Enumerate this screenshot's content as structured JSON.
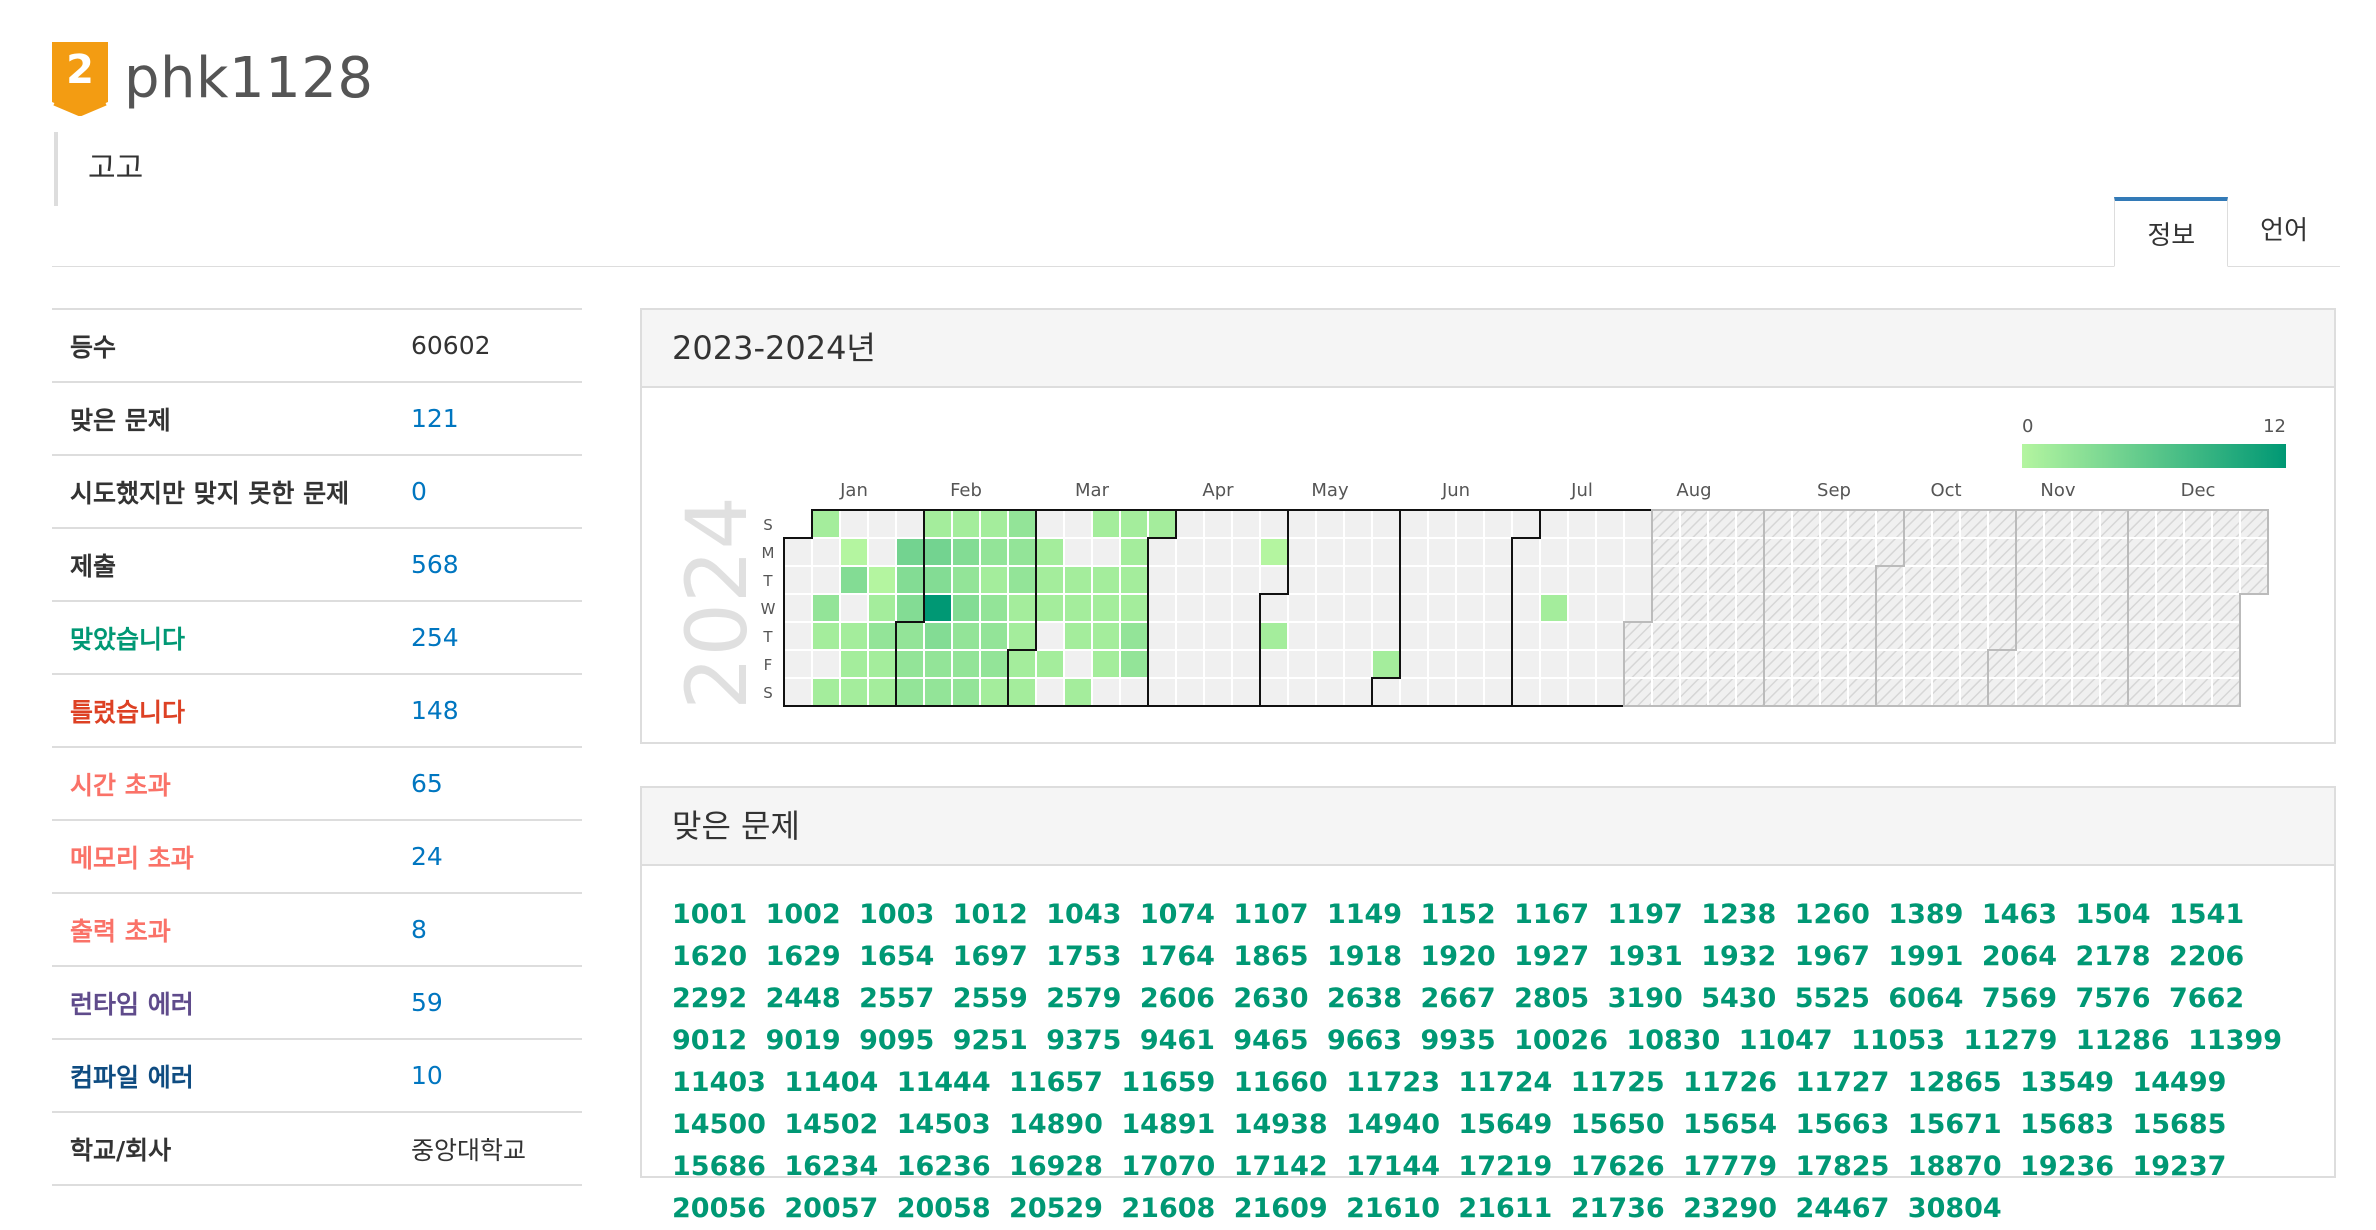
{
  "user": {
    "tier_number": "2",
    "username": "phk1128",
    "status_message": "고고"
  },
  "tabs": [
    {
      "label": "정보",
      "active": true
    },
    {
      "label": "언어",
      "active": false
    }
  ],
  "stats": [
    {
      "label": "등수",
      "value": "60602",
      "label_color": "#333333",
      "value_color": "#333333"
    },
    {
      "label": "맞은 문제",
      "value": "121",
      "label_color": "#333333",
      "value_color": "#0076c0"
    },
    {
      "label": "시도했지만 맞지 못한 문제",
      "value": "0",
      "label_color": "#333333",
      "value_color": "#0076c0"
    },
    {
      "label": "제출",
      "value": "568",
      "label_color": "#333333",
      "value_color": "#0076c0"
    },
    {
      "label": "맞았습니다",
      "value": "254",
      "label_color": "#009874",
      "value_color": "#0076c0"
    },
    {
      "label": "틀렸습니다",
      "value": "148",
      "label_color": "#dd4124",
      "value_color": "#0076c0"
    },
    {
      "label": "시간 초과",
      "value": "65",
      "label_color": "#fa7268",
      "value_color": "#0076c0"
    },
    {
      "label": "메모리 초과",
      "value": "24",
      "label_color": "#fa7268",
      "value_color": "#0076c0"
    },
    {
      "label": "출력 초과",
      "value": "8",
      "label_color": "#fa7268",
      "value_color": "#0076c0"
    },
    {
      "label": "런타임 에러",
      "value": "59",
      "label_color": "#5f4b8b",
      "value_color": "#0076c0"
    },
    {
      "label": "컴파일 에러",
      "value": "10",
      "label_color": "#0f4c81",
      "value_color": "#0076c0"
    },
    {
      "label": "학교/회사",
      "value": "중앙대학교",
      "label_color": "#333333",
      "value_color": "#333333"
    }
  ],
  "calendar": {
    "title": "2023-2024년",
    "year": "2024",
    "legend_min": "0",
    "legend_max": "12",
    "legend_colors": [
      "#b4f5a0",
      "#009874"
    ],
    "months": [
      "Jan",
      "Feb",
      "Mar",
      "Apr",
      "May",
      "Jun",
      "Jul",
      "Aug",
      "Sep",
      "Oct",
      "Nov",
      "Dec"
    ],
    "weekdays": [
      "S",
      "M",
      "T",
      "W",
      "T",
      "F",
      "S"
    ],
    "first_weekday": 1,
    "days_in_year": 366,
    "last_active_day_of_year": 213,
    "activity": [
      {
        "day": 7,
        "level": 2
      },
      {
        "day": 10,
        "level": 3
      },
      {
        "day": 11,
        "level": 2
      },
      {
        "day": 13,
        "level": 2
      },
      {
        "day": 15,
        "level": 1
      },
      {
        "day": 16,
        "level": 4
      },
      {
        "day": 18,
        "level": 2
      },
      {
        "day": 19,
        "level": 2
      },
      {
        "day": 20,
        "level": 2
      },
      {
        "day": 23,
        "level": 1
      },
      {
        "day": 24,
        "level": 2
      },
      {
        "day": 25,
        "level": 3
      },
      {
        "day": 26,
        "level": 2
      },
      {
        "day": 27,
        "level": 2
      },
      {
        "day": 29,
        "level": 5
      },
      {
        "day": 30,
        "level": 4
      },
      {
        "day": 31,
        "level": 4
      },
      {
        "day": 32,
        "level": 3
      },
      {
        "day": 33,
        "level": 3
      },
      {
        "day": 34,
        "level": 3
      },
      {
        "day": 35,
        "level": 2
      },
      {
        "day": 36,
        "level": 5
      },
      {
        "day": 37,
        "level": 4
      },
      {
        "day": 38,
        "level": 12
      },
      {
        "day": 39,
        "level": 4
      },
      {
        "day": 40,
        "level": 3
      },
      {
        "day": 41,
        "level": 3
      },
      {
        "day": 42,
        "level": 2
      },
      {
        "day": 43,
        "level": 4
      },
      {
        "day": 44,
        "level": 3
      },
      {
        "day": 45,
        "level": 4
      },
      {
        "day": 46,
        "level": 3
      },
      {
        "day": 47,
        "level": 3
      },
      {
        "day": 48,
        "level": 3
      },
      {
        "day": 49,
        "level": 2
      },
      {
        "day": 50,
        "level": 3
      },
      {
        "day": 51,
        "level": 2
      },
      {
        "day": 52,
        "level": 3
      },
      {
        "day": 53,
        "level": 3
      },
      {
        "day": 54,
        "level": 3
      },
      {
        "day": 55,
        "level": 2
      },
      {
        "day": 56,
        "level": 3
      },
      {
        "day": 57,
        "level": 3
      },
      {
        "day": 58,
        "level": 3
      },
      {
        "day": 59,
        "level": 2
      },
      {
        "day": 60,
        "level": 2
      },
      {
        "day": 61,
        "level": 2
      },
      {
        "day": 62,
        "level": 2
      },
      {
        "day": 64,
        "level": 2
      },
      {
        "day": 65,
        "level": 2
      },
      {
        "day": 66,
        "level": 2
      },
      {
        "day": 68,
        "level": 2
      },
      {
        "day": 72,
        "level": 2
      },
      {
        "day": 73,
        "level": 2
      },
      {
        "day": 74,
        "level": 2
      },
      {
        "day": 76,
        "level": 2
      },
      {
        "day": 77,
        "level": 2
      },
      {
        "day": 79,
        "level": 2
      },
      {
        "day": 80,
        "level": 2
      },
      {
        "day": 81,
        "level": 2
      },
      {
        "day": 82,
        "level": 2
      },
      {
        "day": 84,
        "level": 2
      },
      {
        "day": 85,
        "level": 2
      },
      {
        "day": 86,
        "level": 2
      },
      {
        "day": 87,
        "level": 2
      },
      {
        "day": 88,
        "level": 3
      },
      {
        "day": 89,
        "level": 3
      },
      {
        "day": 91,
        "level": 2
      },
      {
        "day": 120,
        "level": 1
      },
      {
        "day": 123,
        "level": 2
      },
      {
        "day": 152,
        "level": 2
      },
      {
        "day": 192,
        "level": 2
      }
    ]
  },
  "solved": {
    "title": "맞은 문제",
    "problems": [
      "1001",
      "1002",
      "1003",
      "1012",
      "1043",
      "1074",
      "1107",
      "1149",
      "1152",
      "1167",
      "1197",
      "1238",
      "1260",
      "1389",
      "1463",
      "1504",
      "1541",
      "1620",
      "1629",
      "1654",
      "1697",
      "1753",
      "1764",
      "1865",
      "1918",
      "1920",
      "1927",
      "1931",
      "1932",
      "1967",
      "1991",
      "2064",
      "2178",
      "2206",
      "2292",
      "2448",
      "2557",
      "2559",
      "2579",
      "2606",
      "2630",
      "2638",
      "2667",
      "2805",
      "3190",
      "5430",
      "5525",
      "6064",
      "7569",
      "7576",
      "7662",
      "9012",
      "9019",
      "9095",
      "9251",
      "9375",
      "9461",
      "9465",
      "9663",
      "9935",
      "10026",
      "10830",
      "11047",
      "11053",
      "11279",
      "11286",
      "11399",
      "11403",
      "11404",
      "11444",
      "11657",
      "11659",
      "11660",
      "11723",
      "11724",
      "11725",
      "11726",
      "11727",
      "12865",
      "13549",
      "14499",
      "14500",
      "14502",
      "14503",
      "14890",
      "14891",
      "14938",
      "14940",
      "15649",
      "15650",
      "15654",
      "15663",
      "15671",
      "15683",
      "15685",
      "15686",
      "16234",
      "16236",
      "16928",
      "17070",
      "17142",
      "17144",
      "17219",
      "17626",
      "17779",
      "17825",
      "18870",
      "19236",
      "19237",
      "20056",
      "20057",
      "20058",
      "20529",
      "21608",
      "21609",
      "21610",
      "21611",
      "21736",
      "23290",
      "24467",
      "30804"
    ]
  }
}
